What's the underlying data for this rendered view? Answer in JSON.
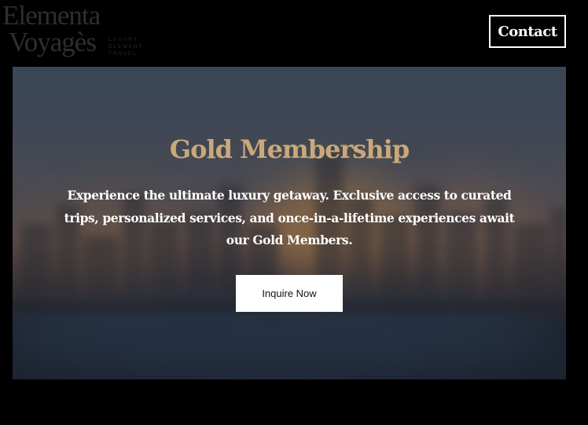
{
  "header": {
    "logo": {
      "line1": "Elementa",
      "line2": "Voyagès",
      "tagline": [
        "LUXURY",
        "ELEMENT",
        "TRAVEL"
      ]
    },
    "contact_label": "Contact"
  },
  "hero": {
    "title": "Gold Membership",
    "description": "Experience the ultimate luxury getaway. Exclusive access to curated trips, personalized services, and once-in-a-lifetime experiences await our Gold Members.",
    "cta_label": "Inquire Now",
    "background_image": "blurred-city-skyline-at-dusk"
  },
  "colors": {
    "page_background": "#000000",
    "title_gold": "#c8a97a",
    "text_white": "#ffffff",
    "button_background": "#ffffff",
    "logo_gray": "#2e2e2e"
  }
}
